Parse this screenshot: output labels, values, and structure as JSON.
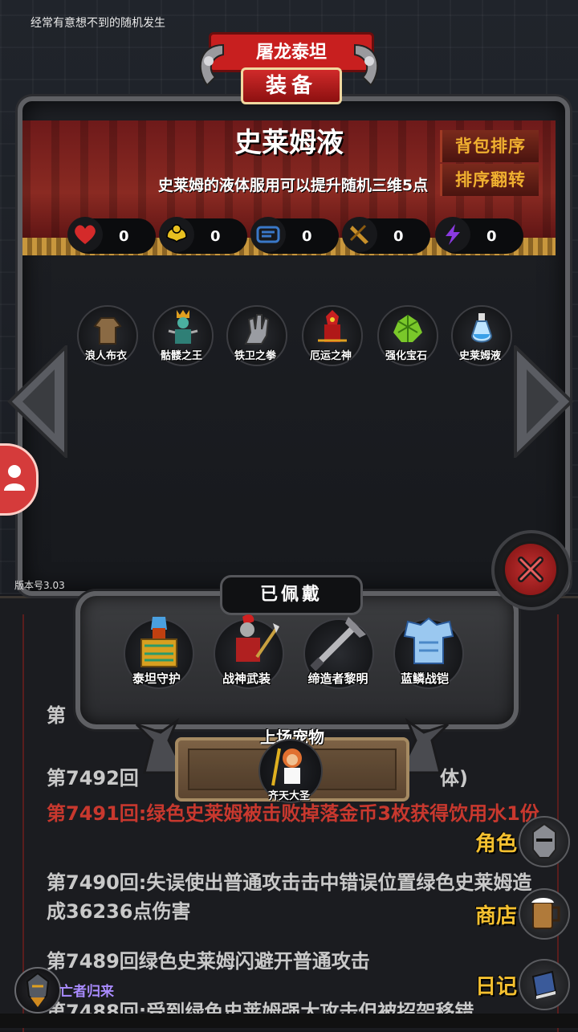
{
  "top_hint": "经常有意想不到的随机发生",
  "version": "版本号3.03",
  "banner": {
    "back_title": "屠龙泰坦",
    "front_title": "装备"
  },
  "item": {
    "name": "史莱姆液",
    "description": "史莱姆的液体服用可以提升随机三维5点"
  },
  "buttons": {
    "sort_bag": "背包排序",
    "sort_reverse": "排序翻转"
  },
  "stats": [
    {
      "icon": "heart-icon",
      "value": "0",
      "color": "#d42a2a"
    },
    {
      "icon": "strength-icon",
      "value": "0",
      "color": "#e8c020"
    },
    {
      "icon": "armor-icon",
      "value": "0",
      "color": "#3a78c8"
    },
    {
      "icon": "weapon-icon",
      "value": "0",
      "color": "#c8902a"
    },
    {
      "icon": "lightning-icon",
      "value": "0",
      "color": "#7a3ad0"
    }
  ],
  "bag_items": [
    {
      "icon": "cloth-robe-icon",
      "label": "浪人布衣"
    },
    {
      "icon": "skeleton-king-icon",
      "label": "骷髅之王"
    },
    {
      "icon": "iron-gauntlet-icon",
      "label": "铁卫之拳"
    },
    {
      "icon": "doom-god-icon",
      "label": "厄运之神"
    },
    {
      "icon": "gem-icon",
      "label": "强化宝石"
    },
    {
      "icon": "potion-icon",
      "label": "史莱姆液"
    }
  ],
  "equipped": {
    "title": "已佩戴",
    "items": [
      {
        "icon": "titan-guard-icon",
        "label": "泰坦守护"
      },
      {
        "icon": "war-god-armor-icon",
        "label": "战神武装"
      },
      {
        "icon": "dawn-blade-icon",
        "label": "缔造者黎明"
      },
      {
        "icon": "blue-scale-armor-icon",
        "label": "蓝鳞战铠"
      }
    ]
  },
  "pet": {
    "title": "上场宠物",
    "name": "齐天大圣"
  },
  "log": [
    {
      "text": "第",
      "style": "grey"
    },
    {
      "text": "第7492回",
      "tail": "体)",
      "style": "grey"
    },
    {
      "text": "第7491回:绿色史莱姆被击败掉落金币3枚获得饮用水1份",
      "style": "red"
    },
    {
      "text": "第7490回:失误使出普通攻击击中错误位置绿色史莱姆造成36236点伤害",
      "style": "grey"
    },
    {
      "text": "第7489回绿色史莱姆闪避开普通攻击",
      "style": "grey"
    },
    {
      "text": "第7488回:受到绿色史莱姆强大攻击但被招架移错",
      "style": "grey"
    }
  ],
  "menu": {
    "role": "角色",
    "shop": "商店",
    "diary": "日记"
  },
  "player": {
    "name": "亡者归来"
  }
}
